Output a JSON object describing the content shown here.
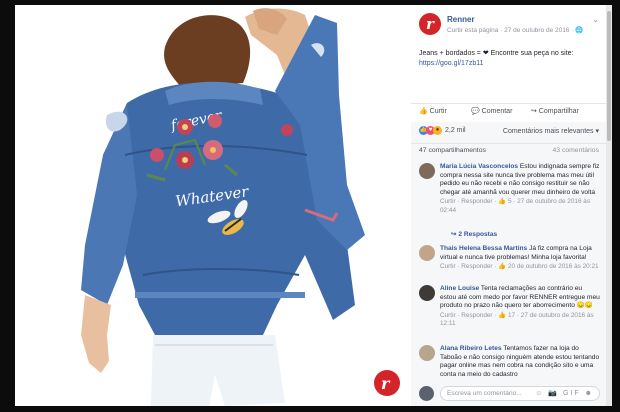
{
  "post": {
    "page_name": "Renner",
    "logo_letter": "r",
    "meta": "Curtir esta página · 27 de outubro de 2016 · 🌐",
    "caption_text": "Jeans + bordados = ❤ Encontre sua peça no site:",
    "caption_link": "https://goo.gl/17zb11",
    "heart": "❤"
  },
  "actions": {
    "like": "👍 Curtir",
    "comment": "💬 Comentar",
    "share": "↪ Compartilhar"
  },
  "reactions": {
    "count": "2,2 mil",
    "sort_label": "Comentários mais relevantes ▾",
    "shares": "47 compartilhamentos",
    "comments_of": "43 comentários"
  },
  "comments": [
    {
      "author": "Maria Lúcia Vasconcelos",
      "text": "Estou indignada sempre fiz compra nessa site nunca tive problema mas meu útil pedido eu não recebi e não consigo restituir se não chegar até amanhã vou querer meu dinheiro de volta",
      "actions": "Curtir · Responder · 👍 5 · 27 de outubro de 2016 às 02:44",
      "replies": "↪ 2 Respostas"
    },
    {
      "author": "Thais Helena Bessa Martins",
      "text": "Já fiz compra na Loja virtual e nunca tive problemas! Minha loja favorita!",
      "actions": "Curtir · Responder · 👍 20 de outubro de 2016 às 20:21"
    },
    {
      "author": "Aline Louise",
      "text": "Tenta reclamações ao contrário eu estou até com medo por favor RENNER entregue meu produto no prazo não quero ter aborrecimento 😞😞",
      "actions": "Curtir · Responder · 👍 17 · 27 de outubro de 2016 às 12:11"
    },
    {
      "author": "Alana Ribeiro Letes",
      "text": "Tentamos fazer na loja do Taboão e não consigo ninguém atende estou tentando pagar online mas nem cobra na condição sito e uma conta na meio do cadastro",
      "actions": ""
    }
  ],
  "write": {
    "placeholder": "Escreva um comentário...",
    "icons": "☺ 📷 GIF ☻"
  },
  "colors": {
    "brand": "#d4242a",
    "link": "#365899",
    "denim": "#3f6aa8"
  }
}
